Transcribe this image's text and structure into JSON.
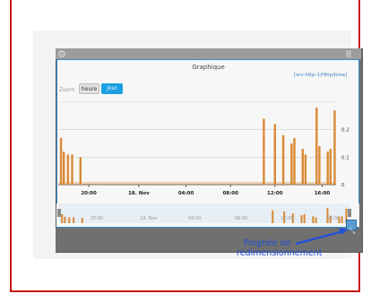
{
  "widget": {
    "title": "Graphique",
    "source_link": "[srv-http-1/Http/time]"
  },
  "zoom": {
    "label": "Zoom",
    "buttons": [
      {
        "label": "heure",
        "active": false
      },
      {
        "label": "jour",
        "active": true
      }
    ]
  },
  "annotation": {
    "line1": "Poignée de",
    "line2": "redimensionnement"
  },
  "icons": {
    "settings": "gear-icon",
    "lock": "lock-icon",
    "resize": "resize-handle-icon"
  },
  "colors": {
    "series": "#d98a35",
    "active_button": "#1c9fe3",
    "annotation": "#1f4fd8",
    "frame": "#c81414"
  },
  "chart_data": {
    "type": "bar",
    "y_ticks": [
      "0",
      "0.1",
      "0.2"
    ],
    "ylim": [
      0,
      0.3
    ],
    "x_ticks": [
      "20:00",
      "18. Nov",
      "04:00",
      "08:00",
      "12:00",
      "16:00"
    ],
    "overview_x_ticks": [
      "20:00",
      "18. Nov",
      "04:00",
      "08:00",
      "12:00",
      "16:00"
    ],
    "grid": true,
    "series": [
      {
        "values": [
          0.17,
          0.12,
          0.11,
          0.1,
          0.24,
          0.22,
          0.18,
          0.15,
          0.17,
          0.13,
          0.11,
          0.28,
          0.14,
          0.12,
          0.13,
          0.27,
          0.11
        ]
      }
    ],
    "x_positions": [
      0.01,
      0.02,
      0.05,
      0.08,
      0.74,
      0.78,
      0.81,
      0.84,
      0.85,
      0.88,
      0.89,
      0.93,
      0.94,
      0.97,
      0.98,
      0.995,
      0.035
    ]
  }
}
